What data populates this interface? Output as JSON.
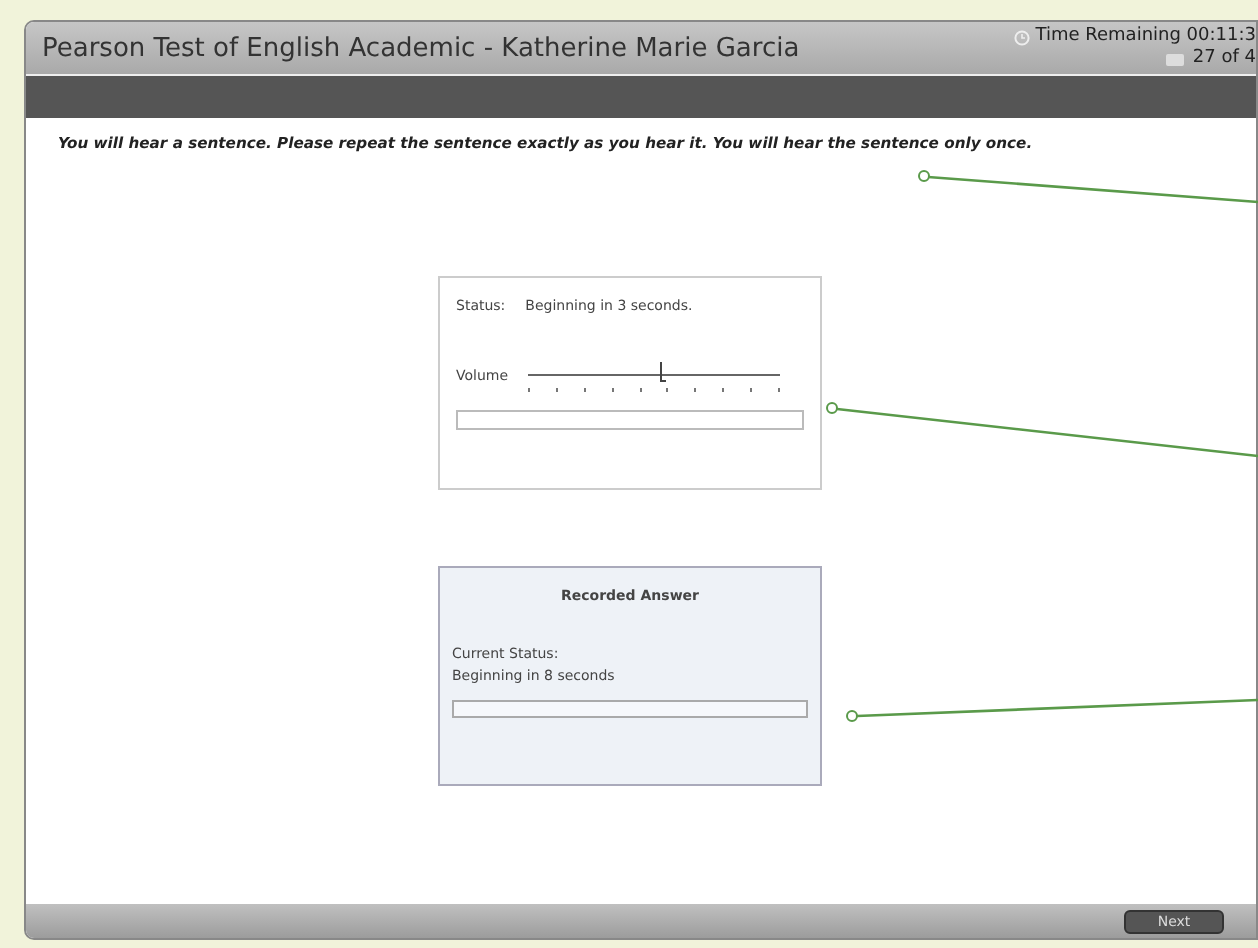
{
  "window": {
    "title": "Pearson Test of English Academic - Katherine Marie Garcia",
    "timer": "Time Remaining 00:11:3",
    "progress": "27 of 4"
  },
  "instruction": "You will hear a sentence. Please repeat the sentence exactly as you hear it.  You will hear the sentence only once.",
  "audio_player": {
    "status_label": "Status:",
    "status": "Beginning in 3 seconds.",
    "volume_label": "Volume",
    "volume": {
      "level": 0.53
    },
    "playback": {
      "level": 0
    }
  },
  "recorder": {
    "title": "Recorded Answer",
    "status_label": "Current Status:",
    "status": "Beginning in 8 seconds",
    "recording": {
      "level": 0
    }
  },
  "buttons": [
    {
      "label": "Next"
    }
  ]
}
